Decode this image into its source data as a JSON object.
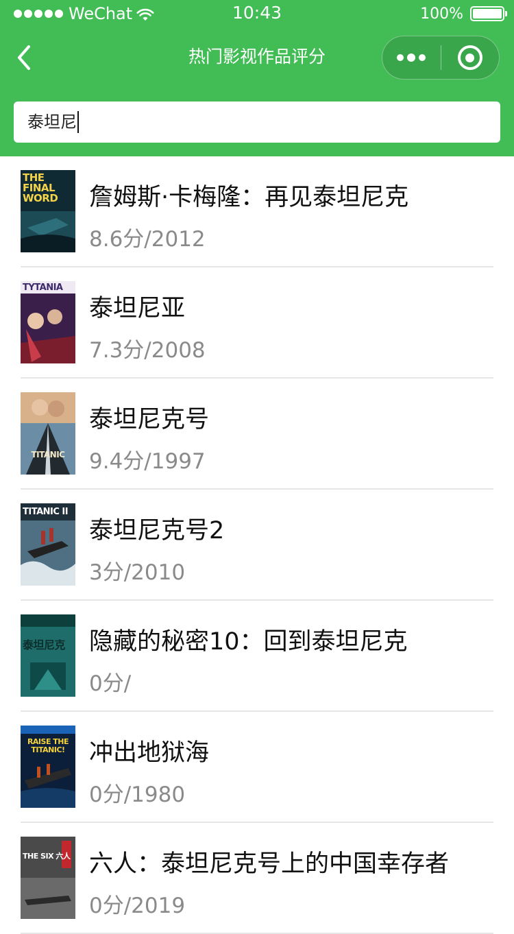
{
  "status_bar": {
    "carrier": "WeChat",
    "time": "10:43",
    "battery": "100%"
  },
  "nav": {
    "title": "热门影视作品评分"
  },
  "search": {
    "value": "泰坦尼"
  },
  "movies": [
    {
      "title": "詹姆斯·卡梅隆：再见泰坦尼克",
      "meta": "8.6分/2012",
      "poster_text": "THE FINAL WORD"
    },
    {
      "title": "泰坦尼亚",
      "meta": "7.3分/2008",
      "poster_text": "TYTANIA"
    },
    {
      "title": "泰坦尼克号",
      "meta": "9.4分/1997",
      "poster_text": "TITANIC"
    },
    {
      "title": "泰坦尼克号2",
      "meta": "3分/2010",
      "poster_text": "TITANIC II"
    },
    {
      "title": "隐藏的秘密10：回到泰坦尼克",
      "meta": "0分/",
      "poster_text": "泰坦尼克"
    },
    {
      "title": "冲出地狱海",
      "meta": "0分/1980",
      "poster_text": "RAISE THE TITANIC!"
    },
    {
      "title": "六人：泰坦尼克号上的中国幸存者",
      "meta": "0分/2019",
      "poster_text": "THE SIX 六人"
    }
  ],
  "colors": {
    "brand_green": "#42bd56",
    "title_text": "#111111",
    "meta_text": "#8a8a8a",
    "divider": "#e6e6e6"
  },
  "icons": {
    "back": "chevron-left-icon",
    "more": "more-dots-icon",
    "close": "target-close-icon",
    "wifi": "wifi-icon",
    "battery": "battery-icon"
  }
}
